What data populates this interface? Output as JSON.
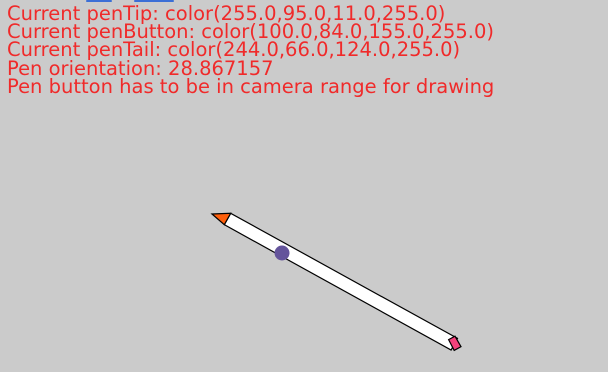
{
  "status": {
    "lines": [
      "Current penTip: color(255.0,95.0,11.0,255.0)",
      "Current penButton: color(100.0,84.0,155.0,255.0)",
      "Current penTail: color(244.0,66.0,124.0,255.0)",
      "Pen orientation: 28.867157",
      "Pen button has to be in camera range for drawing"
    ]
  },
  "colors": {
    "background": "#cbcbcb",
    "text": "#f02a2a",
    "pen_tip": "#ff5f0b",
    "pen_button": "#64549b",
    "pen_tail": "#f4427c",
    "pen_body": "#ffffff",
    "outline": "#000000",
    "top_sliver": "#3b6fd6"
  },
  "pen": {
    "orientation_deg": 28.867157
  }
}
